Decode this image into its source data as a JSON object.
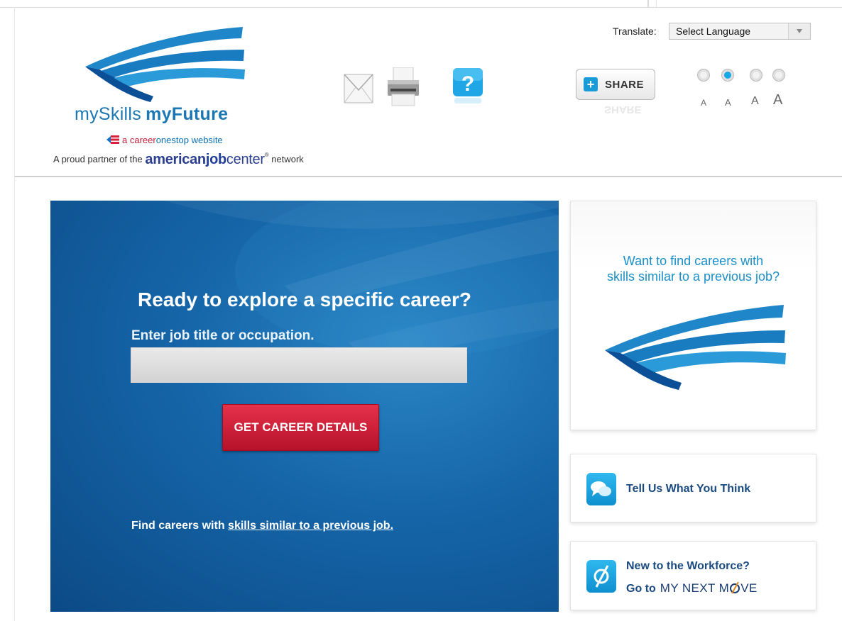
{
  "header": {
    "brand_prefix": "mySkills",
    "brand_strong": "myFuture",
    "tagline_a": "a career",
    "tagline_b": "onestop website",
    "partner_prefix": "A proud partner of the",
    "partner_ajc_1": "american",
    "partner_ajc_2": "job",
    "partner_ajc_3": "center",
    "partner_reg": "®",
    "partner_suffix": "network"
  },
  "tools": {
    "share_label": "SHARE",
    "translate_label": "Translate:",
    "language_selected": "Select Language",
    "font_sizes": [
      "A",
      "A",
      "A",
      "A"
    ],
    "selected_font_size_index": 1
  },
  "hero": {
    "title": "Ready to explore a specific career?",
    "input_label": "Enter job title or occupation.",
    "input_value": "",
    "button_label": "GET CAREER DETAILS",
    "find_prefix": "Find careers with",
    "find_link": "skills similar to a previous job."
  },
  "sidebar": {
    "promo_line1": "Want  to find careers with",
    "promo_line2": "skills similar to a previous job?",
    "feedback_label": "Tell Us What You Think",
    "workforce_line1": "New to the Workforce?",
    "workforce_goto": "Go to",
    "workforce_link_a": "MY NEXT M",
    "workforce_link_b": "VE"
  },
  "colors": {
    "brand_blue": "#1c78b5",
    "hero_blue": "#1565a8",
    "button_red": "#c8203a",
    "accent_cyan": "#16a7e7"
  }
}
